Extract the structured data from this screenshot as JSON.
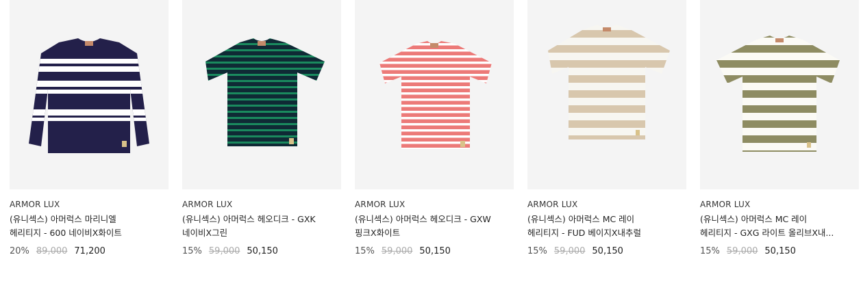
{
  "products": [
    {
      "brand": "ARMOR LUX",
      "name": "(유니섹스) 아머럭스 마리니엘 헤리티지 - 600 네이비X화이트",
      "discount": "20%",
      "original_price": "89,000",
      "sale_price": "71,200",
      "colors": {
        "base": "#23204a",
        "stripe": "#ffffff"
      },
      "icon": "longsleeve-tshirt-icon"
    },
    {
      "brand": "ARMOR LUX",
      "name": "(유니섹스) 아머럭스 헤오디크 - GXK 네이비X그린",
      "discount": "15%",
      "original_price": "59,000",
      "sale_price": "50,150",
      "colors": {
        "base": "#0f2a35",
        "stripe": "#1a8a5e"
      },
      "icon": "tshirt-icon"
    },
    {
      "brand": "ARMOR LUX",
      "name": "(유니섹스) 아머럭스 헤오디크 - GXW 핑크X화이트",
      "discount": "15%",
      "original_price": "59,000",
      "sale_price": "50,150",
      "colors": {
        "base": "#ec7a78",
        "stripe": "#ffffff"
      },
      "icon": "tshirt-icon"
    },
    {
      "brand": "ARMOR LUX",
      "name": "(유니섹스) 아머럭스 MC 레이 헤리티지 - FUD 베이지X내추럴",
      "discount": "15%",
      "original_price": "59,000",
      "sale_price": "50,150",
      "colors": {
        "base": "#d8c7ad",
        "stripe": "#f7f6f1"
      },
      "icon": "tshirt-icon"
    },
    {
      "brand": "ARMOR LUX",
      "name": "(유니섹스) 아머럭스 MC 레이 헤리티지 - GXG 라이트 올리브X내...",
      "discount": "15%",
      "original_price": "59,000",
      "sale_price": "50,150",
      "colors": {
        "base": "#8e8c62",
        "stripe": "#fbfaf5"
      },
      "icon": "tshirt-icon"
    }
  ]
}
